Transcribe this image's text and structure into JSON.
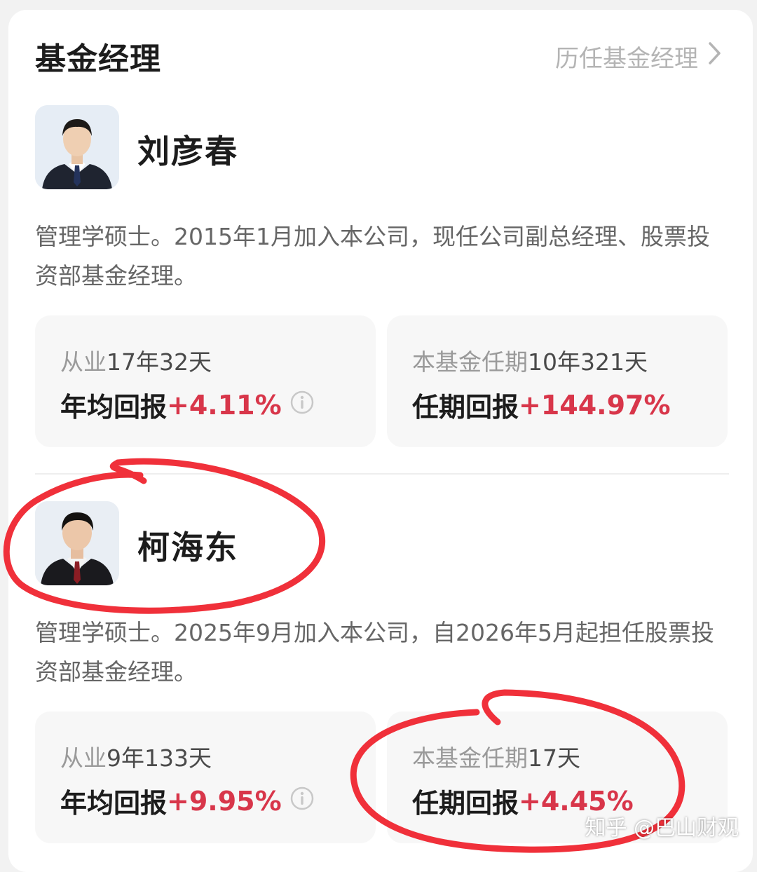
{
  "header": {
    "title": "基金经理",
    "history_link": "历任基金经理",
    "history_icon": "chevron-right-icon"
  },
  "managers": [
    {
      "name": "刘彦春",
      "bio": "管理学硕士。2015年1月加入本公司，现任公司副总经理、股票投资部基金经理。",
      "career": {
        "prefix": "从业",
        "duration": "17年32天",
        "label": "年均回报",
        "value": "+4.11%"
      },
      "tenure": {
        "prefix": "本基金任期",
        "duration": "10年321天",
        "label": "任期回报",
        "value": "+144.97%"
      }
    },
    {
      "name": "柯海东",
      "bio": "管理学硕士。2025年9月加入本公司，自2026年5月起担任股票投资部基金经理。",
      "career": {
        "prefix": "从业",
        "duration": "9年133天",
        "label": "年均回报",
        "value": "+9.95%"
      },
      "tenure": {
        "prefix": "本基金任期",
        "duration": "17天",
        "label": "任期回报",
        "value": "+4.45%"
      }
    }
  ],
  "watermark": "知乎 @巴山财观",
  "colors": {
    "positive": "#d8364a",
    "annotation": "#f0303a",
    "muted": "#b4b4b4"
  }
}
